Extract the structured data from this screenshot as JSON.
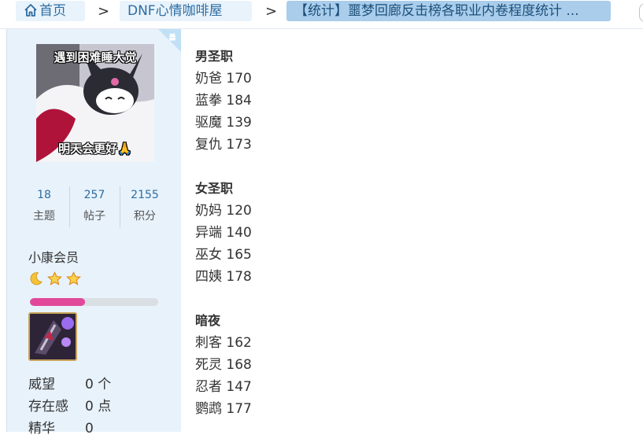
{
  "breadcrumb": {
    "home_label": "首页",
    "forum_label": "DNF心情咖啡屋",
    "current_label": "【统计】噩梦回廊反击榜各职业内卷程度统计 ...",
    "separator": ">"
  },
  "profile": {
    "avatar": {
      "caption_top": "遇到困难睡大觉",
      "caption_bottom": "明天会更好🙏"
    },
    "stats": [
      {
        "value": "18",
        "label": "主题"
      },
      {
        "value": "257",
        "label": "帖子"
      },
      {
        "value": "2155",
        "label": "积分"
      }
    ],
    "rank": "小康会员",
    "level_icons": [
      "moon-icon",
      "star-icon",
      "star-icon"
    ],
    "progress_fraction": 0.43,
    "info": [
      {
        "key": "威望",
        "value": "0 个"
      },
      {
        "key": "存在感",
        "value": "0 点"
      },
      {
        "key": "精华",
        "value": "0"
      }
    ]
  },
  "post": {
    "sections": [
      {
        "title": "男圣职",
        "lines": [
          "奶爸 170",
          "蓝拳 184",
          "驱魔 139",
          "复仇 173"
        ]
      },
      {
        "title": "女圣职",
        "lines": [
          "奶妈 120",
          "异端 140",
          "巫女 165",
          "四姨 178"
        ]
      },
      {
        "title": "暗夜",
        "lines": [
          "刺客 162",
          "死灵 168",
          "忍者 147",
          "鹦鹉 177"
        ]
      }
    ]
  },
  "colors": {
    "accent": "#2d6da3",
    "crumb_bg": "#e9f3fb",
    "crumb_active_bg": "#a9cdeb",
    "sidebar_bg": "#e8f2fb",
    "progress": "#e2489a"
  }
}
